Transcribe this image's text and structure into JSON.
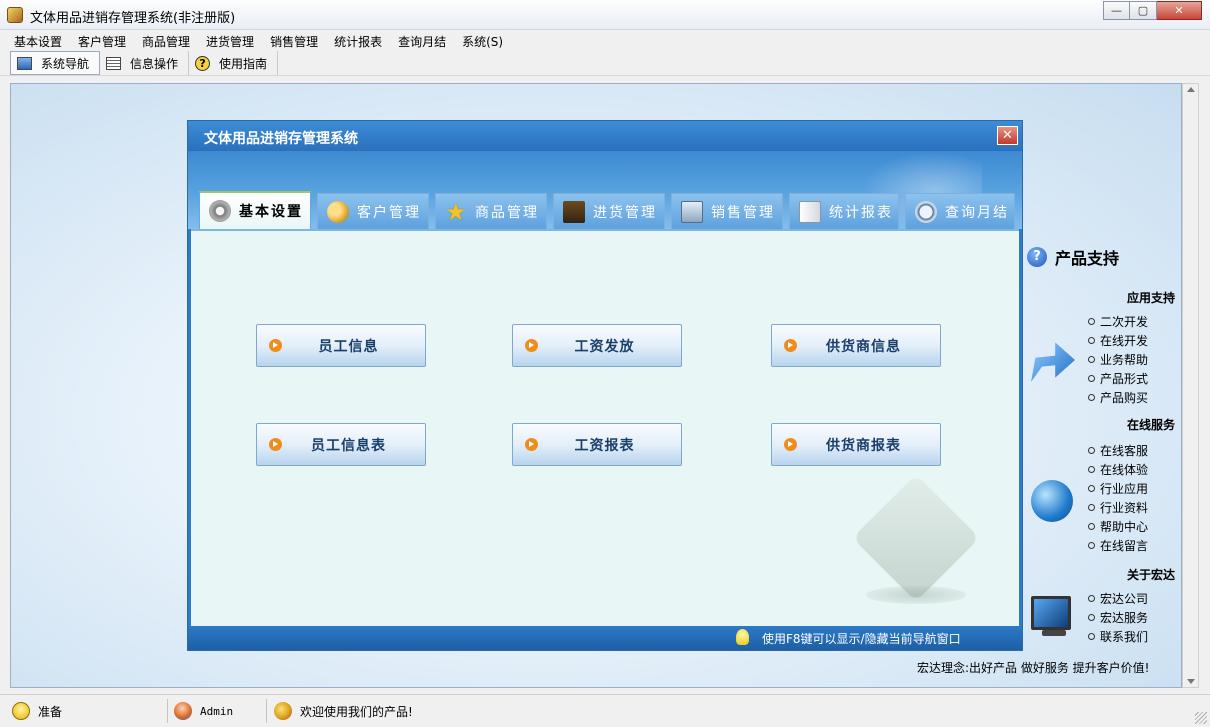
{
  "window": {
    "title": "文体用品进销存管理系统(非注册版)",
    "controls": {
      "minimize": "—",
      "maximize": "▢",
      "close": "✕"
    }
  },
  "menubar": [
    "基本设置",
    "客户管理",
    "商品管理",
    "进货管理",
    "销售管理",
    "统计报表",
    "查询月结",
    "系统(S)"
  ],
  "toolbar": [
    {
      "label": "系统导航",
      "icon": "monitor-icon",
      "active": true
    },
    {
      "label": "信息操作",
      "icon": "grid-icon",
      "active": false
    },
    {
      "label": "使用指南",
      "icon": "help-icon",
      "active": false
    }
  ],
  "dialog": {
    "title": "文体用品进销存管理系统",
    "close": "✕",
    "tabs": [
      {
        "label": "基本设置",
        "icon": "gear-icon",
        "active": true
      },
      {
        "label": "客户管理",
        "icon": "users-icon",
        "active": false
      },
      {
        "label": "商品管理",
        "icon": "star-icon",
        "active": false
      },
      {
        "label": "进货管理",
        "icon": "truck-icon",
        "active": false
      },
      {
        "label": "销售管理",
        "icon": "screen-icon",
        "active": false
      },
      {
        "label": "统计报表",
        "icon": "book-icon",
        "active": false
      },
      {
        "label": "查询月结",
        "icon": "search-icon",
        "active": false
      }
    ],
    "buttons": [
      "员工信息",
      "工资发放",
      "供货商信息",
      "员工信息表",
      "工资报表",
      "供货商报表"
    ],
    "hint": "使用F8键可以显示/隐藏当前导航窗口"
  },
  "support": {
    "title": "产品支持",
    "sections": [
      {
        "title": "应用支持",
        "links": [
          "二次开发",
          "在线开发",
          "业务帮助",
          "产品形式",
          "产品购买"
        ]
      },
      {
        "title": "在线服务",
        "links": [
          "在线客服",
          "在线体验",
          "行业应用",
          "行业资料",
          "帮助中心",
          "在线留言"
        ]
      },
      {
        "title": "关于宏达",
        "links": [
          "宏达公司",
          "宏达服务",
          "联系我们"
        ]
      }
    ],
    "philosophy": "宏达理念:出好产品  做好服务  提升客户价值!"
  },
  "statusbar": {
    "status": "准备",
    "user": "Admin",
    "welcome": "欢迎使用我们的产品!"
  },
  "colors": {
    "dialog_title_bg": "#2a70bd",
    "dialog_body_bg": "#e8f6f5",
    "button_text": "#1a3f6a",
    "arrow_accent": "#f08c1c"
  }
}
